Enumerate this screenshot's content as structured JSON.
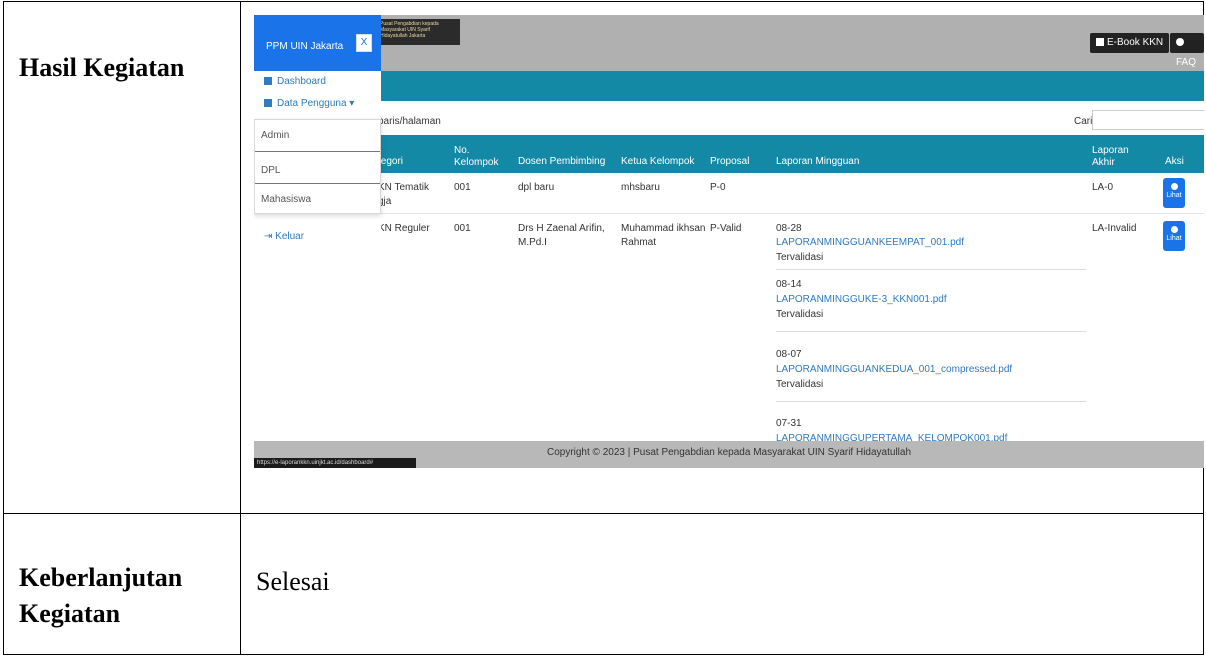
{
  "doc": {
    "row1_label": "Hasil Kegiatan",
    "row2_label": "Keberlanjutan Kegiatan",
    "row2_value": "Selesai"
  },
  "app": {
    "brand": "PPM UIN Jakarta",
    "close": "X",
    "logo_text": "Pusat Pengabdian kepada Masyarakat UIN Syarif Hidayatullah Jakarta",
    "ebook_button": "E-Book KKN",
    "faq_button": "FAQ",
    "perpage_text": "baris/halaman",
    "search_label": "Cari:",
    "status_url": "https://e-laporankkn.uinjkt.ac.id/dashboard#",
    "footer": "Copyright © 2023 | Pusat Pengabdian kepada Masyarakat UIN Syarif Hidayatullah"
  },
  "sidebar": {
    "dashboard": "Dashboard",
    "data_pengguna": "Data Pengguna",
    "dropdown": [
      "Admin",
      "DPL",
      "Mahasiswa"
    ],
    "keluar": "Keluar"
  },
  "table": {
    "headers": {
      "kategori": "tegori",
      "no_kelompok_1": "No.",
      "no_kelompok_2": "Kelompok",
      "dosen": "Dosen Pembimbing",
      "ketua": "Ketua Kelompok",
      "proposal": "Proposal",
      "laporan_mingguan": "Laporan Mingguan",
      "laporan_akhir_1": "Laporan",
      "laporan_akhir_2": "Akhir",
      "aksi": "Aksi"
    },
    "rows": [
      {
        "kategori_1": "KN Tematik",
        "kategori_2": "gja",
        "no": "001",
        "dosen": "dpl baru",
        "ketua": "mhsbaru",
        "proposal": "P-0",
        "akhir": "LA-0",
        "aksi": "Lihat"
      },
      {
        "kategori_1": "KN Reguler",
        "no": "001",
        "dosen_1": "Drs H Zaenal Arifin,",
        "dosen_2": "M.Pd.I",
        "ketua_1": "Muhammad ikhsan",
        "ketua_2": "Rahmat",
        "proposal": "P-Valid",
        "akhir": "LA-Invalid",
        "aksi": "Lihat",
        "mingguan": [
          {
            "date": "08-28",
            "file": "LAPORANMINGGUANKEEMPAT_001.pdf",
            "status": "Tervalidasi"
          },
          {
            "date": "08-14",
            "file": "LAPORANMINGGUKE-3_KKN001.pdf",
            "status": "Tervalidasi"
          },
          {
            "date": "08-07",
            "file": "LAPORANMINGGUANKEDUA_001_compressed.pdf",
            "status": "Tervalidasi"
          },
          {
            "date": "07-31",
            "file": "LAPORANMINGGUPERTAMA_KELOMPOK001.pdf"
          }
        ]
      }
    ]
  }
}
